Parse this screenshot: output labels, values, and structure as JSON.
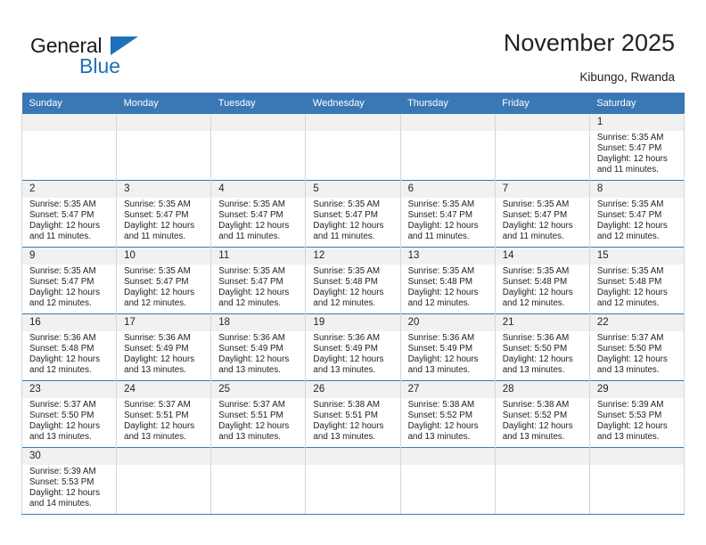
{
  "brand": {
    "name_top": "General",
    "name_bottom": "Blue",
    "triangle_color": "#1e70b8"
  },
  "header": {
    "title": "November 2025",
    "subtitle": "Kibungo, Rwanda"
  },
  "theme": {
    "header_row_bg": "#3a78b5",
    "header_row_text": "#ffffff",
    "daynum_bg": "#f1f1f1",
    "row_divider": "#3a78b5",
    "cell_divider": "#d6d6d6"
  },
  "calendar": {
    "weekday_headers": [
      "Sunday",
      "Monday",
      "Tuesday",
      "Wednesday",
      "Thursday",
      "Friday",
      "Saturday"
    ],
    "labels": {
      "sunrise": "Sunrise:",
      "sunset": "Sunset:",
      "daylight": "Daylight:"
    },
    "weeks": [
      [
        {
          "empty": true
        },
        {
          "empty": true
        },
        {
          "empty": true
        },
        {
          "empty": true
        },
        {
          "empty": true
        },
        {
          "empty": true
        },
        {
          "day": "1",
          "sunrise": "Sunrise: 5:35 AM",
          "sunset": "Sunset: 5:47 PM",
          "daylight": "Daylight: 12 hours and 11 minutes."
        }
      ],
      [
        {
          "day": "2",
          "sunrise": "Sunrise: 5:35 AM",
          "sunset": "Sunset: 5:47 PM",
          "daylight": "Daylight: 12 hours and 11 minutes."
        },
        {
          "day": "3",
          "sunrise": "Sunrise: 5:35 AM",
          "sunset": "Sunset: 5:47 PM",
          "daylight": "Daylight: 12 hours and 11 minutes."
        },
        {
          "day": "4",
          "sunrise": "Sunrise: 5:35 AM",
          "sunset": "Sunset: 5:47 PM",
          "daylight": "Daylight: 12 hours and 11 minutes."
        },
        {
          "day": "5",
          "sunrise": "Sunrise: 5:35 AM",
          "sunset": "Sunset: 5:47 PM",
          "daylight": "Daylight: 12 hours and 11 minutes."
        },
        {
          "day": "6",
          "sunrise": "Sunrise: 5:35 AM",
          "sunset": "Sunset: 5:47 PM",
          "daylight": "Daylight: 12 hours and 11 minutes."
        },
        {
          "day": "7",
          "sunrise": "Sunrise: 5:35 AM",
          "sunset": "Sunset: 5:47 PM",
          "daylight": "Daylight: 12 hours and 11 minutes."
        },
        {
          "day": "8",
          "sunrise": "Sunrise: 5:35 AM",
          "sunset": "Sunset: 5:47 PM",
          "daylight": "Daylight: 12 hours and 12 minutes."
        }
      ],
      [
        {
          "day": "9",
          "sunrise": "Sunrise: 5:35 AM",
          "sunset": "Sunset: 5:47 PM",
          "daylight": "Daylight: 12 hours and 12 minutes."
        },
        {
          "day": "10",
          "sunrise": "Sunrise: 5:35 AM",
          "sunset": "Sunset: 5:47 PM",
          "daylight": "Daylight: 12 hours and 12 minutes."
        },
        {
          "day": "11",
          "sunrise": "Sunrise: 5:35 AM",
          "sunset": "Sunset: 5:47 PM",
          "daylight": "Daylight: 12 hours and 12 minutes."
        },
        {
          "day": "12",
          "sunrise": "Sunrise: 5:35 AM",
          "sunset": "Sunset: 5:48 PM",
          "daylight": "Daylight: 12 hours and 12 minutes."
        },
        {
          "day": "13",
          "sunrise": "Sunrise: 5:35 AM",
          "sunset": "Sunset: 5:48 PM",
          "daylight": "Daylight: 12 hours and 12 minutes."
        },
        {
          "day": "14",
          "sunrise": "Sunrise: 5:35 AM",
          "sunset": "Sunset: 5:48 PM",
          "daylight": "Daylight: 12 hours and 12 minutes."
        },
        {
          "day": "15",
          "sunrise": "Sunrise: 5:35 AM",
          "sunset": "Sunset: 5:48 PM",
          "daylight": "Daylight: 12 hours and 12 minutes."
        }
      ],
      [
        {
          "day": "16",
          "sunrise": "Sunrise: 5:36 AM",
          "sunset": "Sunset: 5:48 PM",
          "daylight": "Daylight: 12 hours and 12 minutes."
        },
        {
          "day": "17",
          "sunrise": "Sunrise: 5:36 AM",
          "sunset": "Sunset: 5:49 PM",
          "daylight": "Daylight: 12 hours and 13 minutes."
        },
        {
          "day": "18",
          "sunrise": "Sunrise: 5:36 AM",
          "sunset": "Sunset: 5:49 PM",
          "daylight": "Daylight: 12 hours and 13 minutes."
        },
        {
          "day": "19",
          "sunrise": "Sunrise: 5:36 AM",
          "sunset": "Sunset: 5:49 PM",
          "daylight": "Daylight: 12 hours and 13 minutes."
        },
        {
          "day": "20",
          "sunrise": "Sunrise: 5:36 AM",
          "sunset": "Sunset: 5:49 PM",
          "daylight": "Daylight: 12 hours and 13 minutes."
        },
        {
          "day": "21",
          "sunrise": "Sunrise: 5:36 AM",
          "sunset": "Sunset: 5:50 PM",
          "daylight": "Daylight: 12 hours and 13 minutes."
        },
        {
          "day": "22",
          "sunrise": "Sunrise: 5:37 AM",
          "sunset": "Sunset: 5:50 PM",
          "daylight": "Daylight: 12 hours and 13 minutes."
        }
      ],
      [
        {
          "day": "23",
          "sunrise": "Sunrise: 5:37 AM",
          "sunset": "Sunset: 5:50 PM",
          "daylight": "Daylight: 12 hours and 13 minutes."
        },
        {
          "day": "24",
          "sunrise": "Sunrise: 5:37 AM",
          "sunset": "Sunset: 5:51 PM",
          "daylight": "Daylight: 12 hours and 13 minutes."
        },
        {
          "day": "25",
          "sunrise": "Sunrise: 5:37 AM",
          "sunset": "Sunset: 5:51 PM",
          "daylight": "Daylight: 12 hours and 13 minutes."
        },
        {
          "day": "26",
          "sunrise": "Sunrise: 5:38 AM",
          "sunset": "Sunset: 5:51 PM",
          "daylight": "Daylight: 12 hours and 13 minutes."
        },
        {
          "day": "27",
          "sunrise": "Sunrise: 5:38 AM",
          "sunset": "Sunset: 5:52 PM",
          "daylight": "Daylight: 12 hours and 13 minutes."
        },
        {
          "day": "28",
          "sunrise": "Sunrise: 5:38 AM",
          "sunset": "Sunset: 5:52 PM",
          "daylight": "Daylight: 12 hours and 13 minutes."
        },
        {
          "day": "29",
          "sunrise": "Sunrise: 5:39 AM",
          "sunset": "Sunset: 5:53 PM",
          "daylight": "Daylight: 12 hours and 13 minutes."
        }
      ],
      [
        {
          "day": "30",
          "sunrise": "Sunrise: 5:39 AM",
          "sunset": "Sunset: 5:53 PM",
          "daylight": "Daylight: 12 hours and 14 minutes."
        },
        {
          "empty": true
        },
        {
          "empty": true
        },
        {
          "empty": true
        },
        {
          "empty": true
        },
        {
          "empty": true
        },
        {
          "empty": true
        }
      ]
    ]
  }
}
